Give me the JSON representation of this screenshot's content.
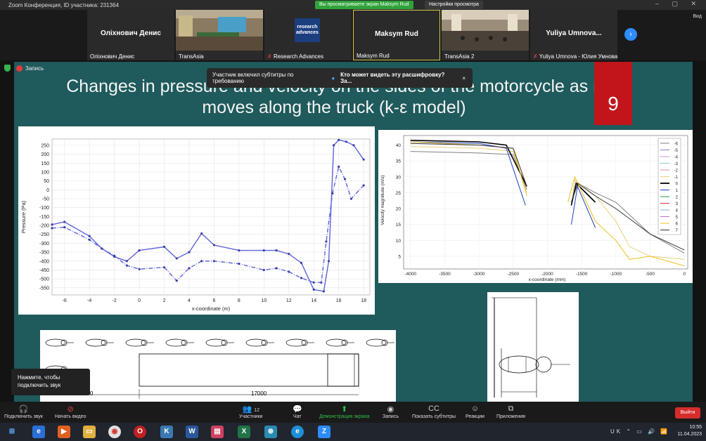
{
  "window": {
    "title": "Zoom Конференция, ID участника: 231364",
    "sharing_label": "Вы просматриваете экран Maksym Rud",
    "view_settings": "Настройки просмотра",
    "view_label": "Вид"
  },
  "participants": [
    {
      "big": "Оліхнович Денис",
      "name": "Оліхнович Денис"
    },
    {
      "big": "",
      "name": "TransAsia"
    },
    {
      "big": "",
      "name": "Research Advances",
      "logo": "research advances"
    },
    {
      "big": "Maksym Rud",
      "name": "Maksym Rud"
    },
    {
      "big": "",
      "name": "TransAsia 2"
    },
    {
      "big": "Yuliya  Umnova...",
      "name": "Yuliya Umnova - Юлия Умнова"
    }
  ],
  "recording": {
    "label": "Запись"
  },
  "subtitle_banner": {
    "text": "Участник включил субтитры по требованию",
    "link": "Кто может видеть эту расшифровку? За...",
    "close": "×"
  },
  "slide": {
    "title": "Changes in pressure and velocity on the sides of the motorcycle as it moves along the truck (k-ε model)",
    "number": "9"
  },
  "pressure_chart": {
    "xlabel": "x-coordinate (m)",
    "ylabel": "Pressure (Pa)",
    "xticks": [
      "-6",
      "-4",
      "-2",
      "0",
      "2",
      "4",
      "6",
      "8",
      "10",
      "12",
      "14",
      "16",
      "18"
    ],
    "yticks": [
      "250",
      "200",
      "150",
      "100",
      "50",
      "0",
      "-50",
      "-100",
      "-150",
      "-200",
      "-250",
      "-300",
      "-350",
      "-400",
      "-450",
      "-500",
      "-550"
    ]
  },
  "velocity_chart": {
    "xlabel": "x-coordinate (mm)",
    "ylabel": "Velocity magnitude (m/s)",
    "xticks": [
      "-4000",
      "-3500",
      "-3000",
      "-2500",
      "-2000",
      "-1500",
      "-1000",
      "-500",
      "0"
    ],
    "yticks": [
      "40",
      "35",
      "30",
      "25",
      "20",
      "15",
      "10",
      "5"
    ],
    "legend": [
      "-6",
      "-5",
      "-4",
      "-3",
      "-2",
      "-1",
      "0",
      "1",
      "2",
      "3",
      "4",
      "5",
      "6",
      "7"
    ],
    "colors": [
      "#7f7f7f",
      "#8c7bbf",
      "#d88fd8",
      "#7fd0d0",
      "#e08ab0",
      "#e8d07a",
      "#000000",
      "#1f3fbf",
      "#2a9b3c",
      "#d63a3a",
      "#7fb0e0",
      "#c070c0",
      "#f0c020",
      "#333333"
    ]
  },
  "chart_data": [
    {
      "type": "line",
      "title": "",
      "xlabel": "x-coordinate (m)",
      "ylabel": "Pressure (Pa)",
      "xlim": [
        -7,
        18.5
      ],
      "ylim": [
        -590,
        285
      ],
      "series": [
        {
          "name": "",
          "x": [
            -7,
            -6,
            -4,
            -3,
            -2,
            -1,
            0,
            2,
            3,
            4,
            5,
            6,
            8,
            10,
            11,
            12,
            13,
            14,
            14.8,
            15.2,
            15.6,
            16,
            16.6,
            17.2,
            18
          ],
          "y": [
            -195,
            -180,
            -260,
            -330,
            -375,
            -400,
            -340,
            -320,
            -385,
            -350,
            -245,
            -310,
            -340,
            -340,
            -340,
            -360,
            -410,
            -560,
            -570,
            -400,
            250,
            280,
            270,
            250,
            170
          ]
        },
        {
          "name": "",
          "x": [
            -7,
            -6,
            -4,
            -3,
            -2,
            -1,
            0,
            2,
            3,
            4,
            5,
            6,
            8,
            10,
            11,
            12,
            13,
            14,
            14.6,
            15,
            15.5,
            16,
            16.5,
            17,
            18
          ],
          "y": [
            -215,
            -210,
            -280,
            -330,
            -370,
            -425,
            -445,
            -435,
            -510,
            -440,
            -400,
            -400,
            -415,
            -450,
            -440,
            -460,
            -495,
            -520,
            -520,
            -290,
            -20,
            130,
            60,
            -50,
            25
          ]
        }
      ]
    },
    {
      "type": "line",
      "title": "",
      "xlabel": "x-coordinate (mm)",
      "ylabel": "Velocity magnitude (m/s)",
      "xlim": [
        -4100,
        50
      ],
      "ylim": [
        1,
        43
      ],
      "series": [
        {
          "name": "-6",
          "x": [
            -4000,
            -3000,
            -2500,
            -2300,
            -1650,
            -1550,
            -1300,
            -1000,
            -500,
            0
          ],
          "y": [
            38,
            37.5,
            37,
            26,
            22,
            28,
            25,
            22,
            12,
            6
          ]
        },
        {
          "name": "-1",
          "x": [
            -4000,
            -3000,
            -2500,
            -2300,
            -1650,
            -1600,
            -1300,
            -1000,
            -800,
            -500,
            0
          ],
          "y": [
            39.5,
            39,
            38,
            25,
            21,
            29,
            24,
            16,
            8,
            5,
            4
          ]
        },
        {
          "name": "0",
          "x": [
            -4000,
            -3000,
            -2600,
            -2300,
            -1650,
            -1580,
            -1300
          ],
          "y": [
            41.5,
            41,
            40,
            27,
            21,
            28,
            22
          ]
        },
        {
          "name": "1",
          "x": [
            -4000,
            -3000,
            -2600,
            -2320,
            -1650,
            -1560,
            -1300
          ],
          "y": [
            41,
            40.5,
            39,
            21,
            15,
            27,
            14
          ]
        },
        {
          "name": "6",
          "x": [
            -4000,
            -3000,
            -2500,
            -2300,
            -1700,
            -1600,
            -1300,
            -1000,
            -800,
            -500,
            0
          ],
          "y": [
            41,
            40,
            39,
            24,
            22,
            30,
            16,
            10,
            4,
            5,
            2
          ]
        },
        {
          "name": "7",
          "x": [
            -4000,
            -3000,
            -2500,
            -2300,
            -1650,
            -1560,
            -1300,
            -1000,
            -500,
            0
          ],
          "y": [
            40.5,
            40,
            39,
            27,
            22,
            28,
            24,
            20,
            12,
            7
          ]
        }
      ]
    }
  ],
  "diagram": {
    "dim1": "800",
    "dim2": "17000"
  },
  "tooltip": {
    "text": "Нажмите, чтобы подключить звук"
  },
  "toolbar": {
    "audio": "Подключить звук",
    "video": "Начать видео",
    "participants": "Участники",
    "participants_count": "12",
    "chat": "Чат",
    "share": "Демонстрация экрана",
    "record": "Запись",
    "captions": "Показать субтитры",
    "reactions": "Реакции",
    "apps": "Приложения",
    "exit": "Выйти"
  },
  "taskbar": {
    "lang": "UK",
    "time": "10:55",
    "date": "11.04.2023"
  }
}
